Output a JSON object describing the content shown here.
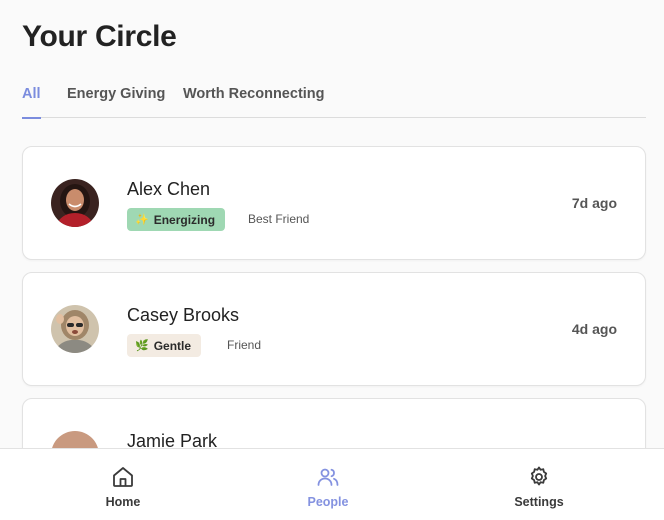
{
  "page": {
    "title": "Your Circle"
  },
  "tabs": [
    {
      "label": "All",
      "active": true
    },
    {
      "label": "Energy Giving",
      "active": false
    },
    {
      "label": "Worth Reconnecting",
      "active": false
    }
  ],
  "people": [
    {
      "name": "Alex Chen",
      "badge": {
        "label": "Energizing",
        "icon": "sparkle-icon",
        "glyph": "✨",
        "bg": "#9fd8b3"
      },
      "relation": "Best Friend",
      "last_contact": "7d ago"
    },
    {
      "name": "Casey Brooks",
      "badge": {
        "label": "Gentle",
        "icon": "leaf-icon",
        "glyph": "🌿",
        "bg": "#f3ebe2"
      },
      "relation": "Friend",
      "last_contact": "4d ago"
    },
    {
      "name": "Jamie Park"
    }
  ],
  "nav": [
    {
      "label": "Home",
      "icon": "home-icon",
      "active": false
    },
    {
      "label": "People",
      "icon": "people-icon",
      "active": true
    },
    {
      "label": "Settings",
      "icon": "gear-icon",
      "active": false
    }
  ],
  "colors": {
    "accent": "#7b8cde",
    "energizing_bg": "#9fd8b3",
    "gentle_bg": "#f3ebe2"
  }
}
